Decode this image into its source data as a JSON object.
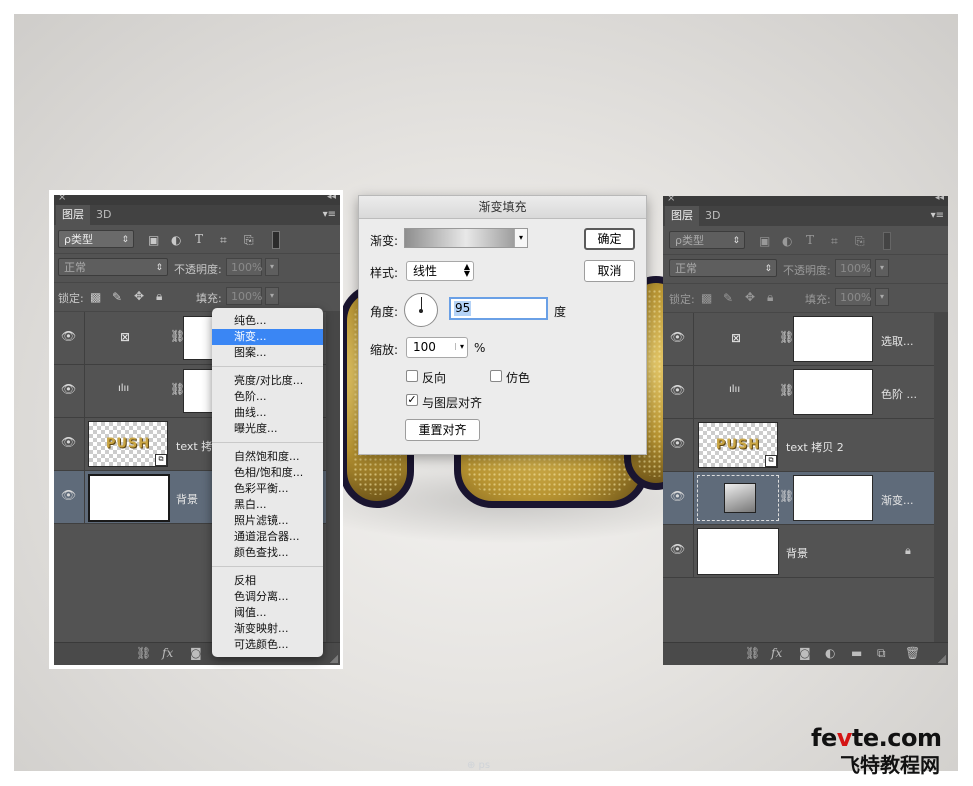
{
  "left_panel": {
    "tabs": [
      "图层",
      "3D"
    ],
    "filter_kind": "ρ类型",
    "blend_mode": "正常",
    "opacity_label": "不透明度:",
    "opacity_value": "100%",
    "lock_label": "锁定:",
    "fill_label": "填充:",
    "fill_value": "100%",
    "layers": [
      {
        "name": ""
      },
      {
        "name": ""
      },
      {
        "name": "text 拷贝 2",
        "thumb_text": "PUSH"
      },
      {
        "name": "背景"
      }
    ]
  },
  "adjustment_menu": {
    "items_group1": [
      "纯色...",
      "渐变...",
      "图案..."
    ],
    "items_group2": [
      "亮度/对比度...",
      "色阶...",
      "曲线...",
      "曝光度..."
    ],
    "items_group3": [
      "自然饱和度...",
      "色相/饱和度...",
      "色彩平衡...",
      "黑白...",
      "照片滤镜...",
      "通道混合器...",
      "颜色查找..."
    ],
    "items_group4": [
      "反相",
      "色调分离...",
      "阈值...",
      "渐变映射...",
      "可选颜色..."
    ],
    "highlighted": "渐变..."
  },
  "dialog": {
    "title": "渐变填充",
    "gradient_label": "渐变:",
    "style_label": "样式:",
    "style_value": "线性",
    "angle_label": "角度:",
    "angle_value": "95",
    "angle_unit": "度",
    "scale_label": "缩放:",
    "scale_value": "100",
    "scale_unit": "%",
    "reverse_label": "反向",
    "dither_label": "仿色",
    "align_label": "与图层对齐",
    "align_checked": true,
    "reverse_checked": false,
    "dither_checked": false,
    "reset_align_button": "重置对齐",
    "ok_button": "确定",
    "cancel_button": "取消"
  },
  "right_panel": {
    "tabs": [
      "图层",
      "3D"
    ],
    "filter_kind": "ρ类型",
    "blend_mode": "正常",
    "opacity_label": "不透明度:",
    "opacity_value": "100%",
    "lock_label": "锁定:",
    "fill_label": "填充:",
    "fill_value": "100%",
    "layers": [
      {
        "name": "选取..."
      },
      {
        "name": "色阶 ..."
      },
      {
        "name": "text 拷贝 2",
        "thumb_text": "PUSH"
      },
      {
        "name": "渐变..."
      },
      {
        "name": "背景"
      }
    ]
  },
  "branding": {
    "logo_fe": "fe",
    "logo_v": "v",
    "logo_rest": "te.com",
    "logo_cn": "飞特教程网"
  }
}
